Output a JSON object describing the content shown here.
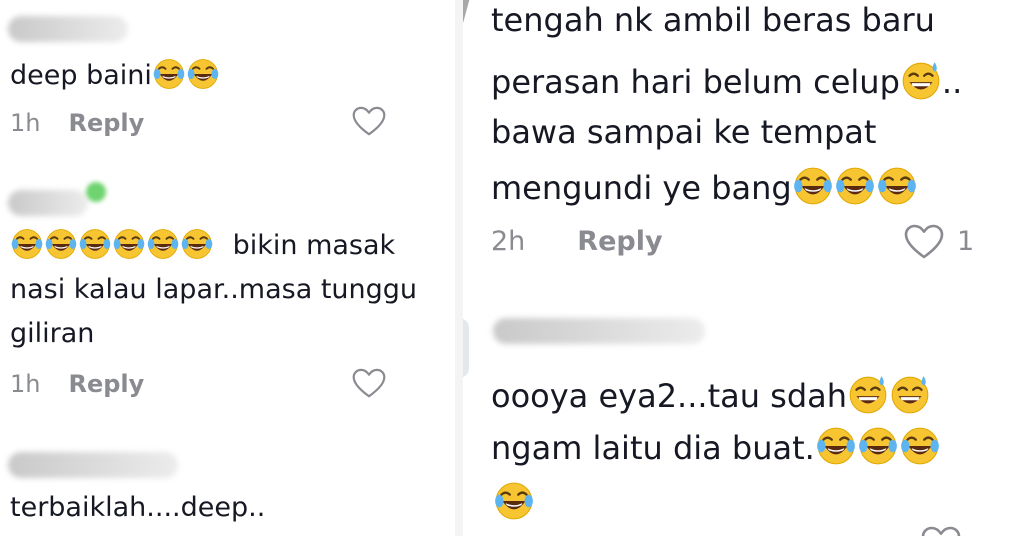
{
  "left": {
    "comments": [
      {
        "text": "deep baini",
        "emojis": 2,
        "time": "1h",
        "reply": "Reply"
      },
      {
        "text_after": "bikin masak",
        "emojis_before": 6,
        "line2": "nasi kalau lapar..masa tunggu",
        "line3": "giliran",
        "time": "1h",
        "reply": "Reply"
      },
      {
        "text": "terbaiklah....deep.."
      }
    ]
  },
  "right": {
    "comments": [
      {
        "line1": "tengah nk ambil beras baru",
        "line2": "perasan hari belum celup",
        "line2_suffix": "..",
        "line3": "bawa sampai ke tempat",
        "line4": "mengundi ye bang",
        "time": "2h",
        "reply": "Reply",
        "likes": "1"
      },
      {
        "line1": "oooya eya2...tau sdah",
        "line2": "ngam laitu dia buat.",
        "emoji_line3": 1
      }
    ]
  },
  "icons": {
    "heart": "heart-outline-icon",
    "laugh": "face-with-tears-of-joy-icon",
    "sweat": "grinning-face-with-sweat-icon"
  },
  "colors": {
    "text": "#161823",
    "meta": "#8a8b91",
    "emoji": "#f7c531"
  }
}
